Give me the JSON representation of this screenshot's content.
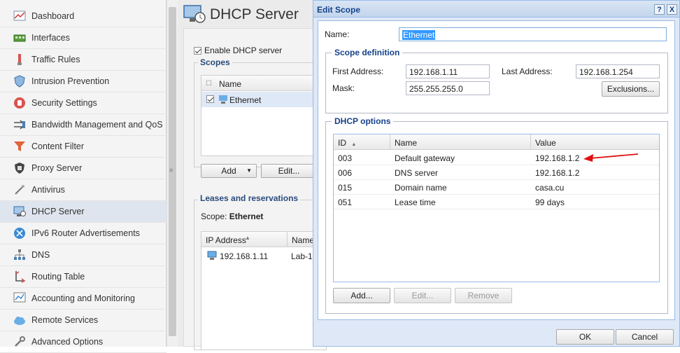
{
  "sidebar": {
    "items": [
      {
        "label": "Dashboard",
        "icon": "dashboard-icon"
      },
      {
        "label": "Interfaces",
        "icon": "network-card-icon"
      },
      {
        "label": "Traffic Rules",
        "icon": "traffic-rules-icon"
      },
      {
        "label": "Intrusion Prevention",
        "icon": "shield-icon"
      },
      {
        "label": "Security Settings",
        "icon": "hand-stop-icon"
      },
      {
        "label": "Bandwidth Management and QoS",
        "icon": "bandwidth-icon"
      },
      {
        "label": "Content Filter",
        "icon": "funnel-icon"
      },
      {
        "label": "Proxy Server",
        "icon": "proxy-icon"
      },
      {
        "label": "Antivirus",
        "icon": "antivirus-icon"
      },
      {
        "label": "DHCP Server",
        "icon": "dhcp-icon"
      },
      {
        "label": "IPv6 Router Advertisements",
        "icon": "router-icon"
      },
      {
        "label": "DNS",
        "icon": "dns-icon"
      },
      {
        "label": "Routing Table",
        "icon": "routing-icon"
      },
      {
        "label": "Accounting and Monitoring",
        "icon": "monitoring-icon"
      },
      {
        "label": "Remote Services",
        "icon": "cloud-icon"
      },
      {
        "label": "Advanced Options",
        "icon": "tools-icon"
      }
    ],
    "active_index": 9
  },
  "main": {
    "title": "DHCP Server",
    "enable_label": "Enable DHCP server",
    "scopes_legend": "Scopes",
    "scopes_col_name": "Name",
    "scope_row_name": "Ethernet",
    "add_label": "Add",
    "edit_label": "Edit...",
    "leases_legend": "Leases and reservations",
    "scope_prefix": "Scope:",
    "scope_value": "Ethernet",
    "leases_col_ip": "IP Address",
    "leases_col_name": "Name",
    "lease_ip": "192.168.1.11",
    "lease_name": "Lab-1"
  },
  "dialog": {
    "title": "Edit Scope",
    "help_btn": "?",
    "close_btn": "X",
    "name_label": "Name:",
    "name_value": "Ethernet",
    "scope_def_legend": "Scope definition",
    "first_label": "First Address:",
    "first_value": "192.168.1.11",
    "last_label": "Last Address:",
    "last_value": "192.168.1.254",
    "mask_label": "Mask:",
    "mask_value": "255.255.255.0",
    "exclusions_label": "Exclusions...",
    "options_legend": "DHCP options",
    "columns": [
      "ID",
      "Name",
      "Value"
    ],
    "rows": [
      {
        "id": "003",
        "name": "Default gateway",
        "value": "192.168.1.2"
      },
      {
        "id": "006",
        "name": "DNS server",
        "value": "192.168.1.2"
      },
      {
        "id": "015",
        "name": "Domain name",
        "value": "casa.cu"
      },
      {
        "id": "051",
        "name": "Lease time",
        "value": "99 days"
      }
    ],
    "add_label": "Add...",
    "edit_label": "Edit...",
    "remove_label": "Remove",
    "ok_label": "OK",
    "cancel_label": "Cancel"
  },
  "colors": {
    "accent": "#15428b",
    "arrow": "#e01010",
    "selection": "#3399ff"
  }
}
